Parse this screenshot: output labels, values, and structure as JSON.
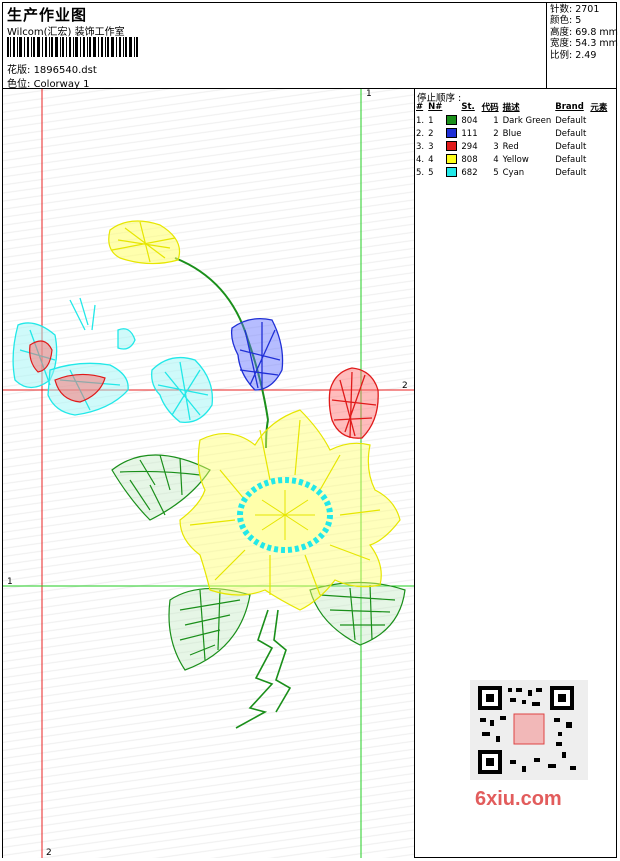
{
  "header": {
    "title": "生产作业图",
    "company": "Wilcom(汇宏) 装饰工作室",
    "design_label": "花版:",
    "design_value": "1896540.dst",
    "colorway_label": "色位:",
    "colorway_value": "Colorway 1"
  },
  "stats": {
    "stitches": "针数: 2701",
    "colors": "颜色: 5",
    "height": "高度: 69.8 mm",
    "width": "宽度: 54.3 mm",
    "scale": "比例: 2.49"
  },
  "sequence": {
    "title": "停止顺序 :",
    "headers": [
      "#",
      "N#",
      "St.",
      "代码",
      "描述",
      "Brand",
      "元素"
    ],
    "rows": [
      {
        "idx": "1.",
        "n": "1",
        "color": "#1a8f1a",
        "st": "804",
        "code": "1",
        "desc": "Dark Green",
        "brand": "Default"
      },
      {
        "idx": "2.",
        "n": "2",
        "color": "#1f2fd6",
        "st": "111",
        "code": "2",
        "desc": "Blue",
        "brand": "Default"
      },
      {
        "idx": "3.",
        "n": "3",
        "color": "#e01a1a",
        "st": "294",
        "code": "3",
        "desc": "Red",
        "brand": "Default"
      },
      {
        "idx": "4.",
        "n": "4",
        "color": "#ffff1a",
        "st": "808",
        "code": "4",
        "desc": "Yellow",
        "brand": "Default"
      },
      {
        "idx": "5.",
        "n": "5",
        "color": "#22e8e8",
        "st": "682",
        "code": "5",
        "desc": "Cyan",
        "brand": "Default"
      }
    ]
  },
  "guides": {
    "v1": "1",
    "h2": "2",
    "h1": "1",
    "v2": "2"
  },
  "watermark": "6xiu.com",
  "colors": {
    "green": "#1a8f1a",
    "blue": "#1f2fd6",
    "red": "#e01a1a",
    "yellow": "#ffff1a",
    "cyan": "#22e8e8",
    "guide_red": "#e82020",
    "guide_green": "#22cc22"
  }
}
